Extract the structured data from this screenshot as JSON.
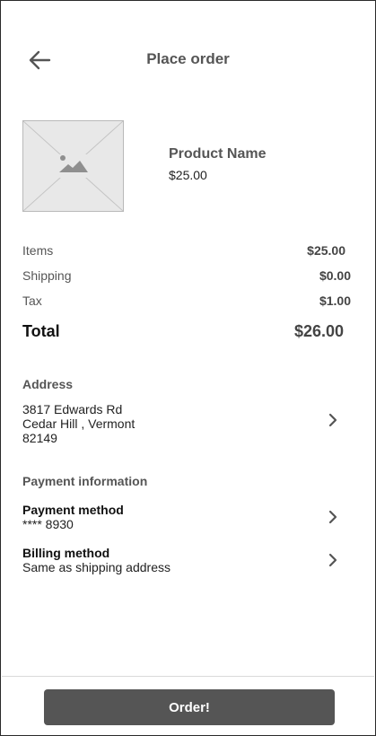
{
  "header": {
    "title": "Place order",
    "back_icon": "arrow-left-icon"
  },
  "product": {
    "name": "Product Name",
    "price": "$25.00",
    "image_icon": "image-placeholder-icon"
  },
  "summary": {
    "items_label": "Items",
    "items_value": "$25.00",
    "shipping_label": "Shipping",
    "shipping_value": "$0.00",
    "tax_label": "Tax",
    "tax_value": "$1.00",
    "total_label": "Total",
    "total_value": "$26.00"
  },
  "address": {
    "heading": "Address",
    "line1": "3817 Edwards Rd",
    "line2": "Cedar Hill , Vermont",
    "line3": "82149"
  },
  "payment": {
    "heading": "Payment information",
    "method_label": "Payment method",
    "method_value": "**** 8930",
    "billing_label": "Billing method",
    "billing_value": "Same as shipping address"
  },
  "footer": {
    "order_label": "Order!",
    "button_color": "#555555"
  }
}
